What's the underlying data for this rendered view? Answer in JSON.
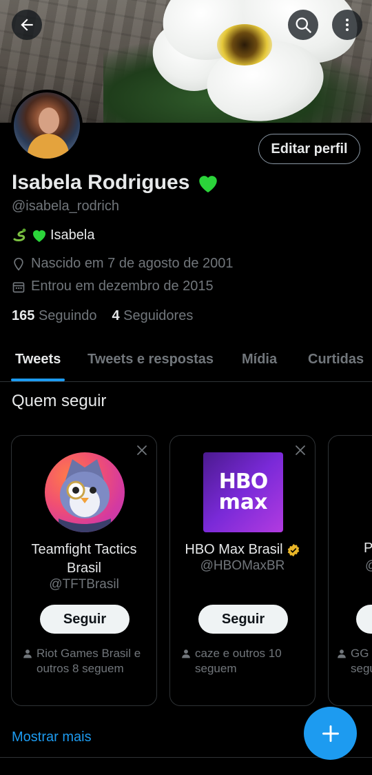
{
  "profile": {
    "name": "Isabela Rodrigues",
    "handle": "@isabela_rodrich",
    "bio": "Isabela",
    "born": "Nascido em 7 de agosto de 2001",
    "joined": "Entrou em dezembro de 2015",
    "following_count": "165",
    "following_label": "Seguindo",
    "followers_count": "4",
    "followers_label": "Seguidores",
    "edit_label": "Editar perfil"
  },
  "tabs": [
    {
      "label": "Tweets",
      "active": true
    },
    {
      "label": "Tweets e respostas",
      "active": false
    },
    {
      "label": "Mídia",
      "active": false
    },
    {
      "label": "Curtidas",
      "active": false
    }
  ],
  "who_to_follow": {
    "title": "Quem seguir",
    "show_more": "Mostrar mais",
    "cards": [
      {
        "name_line1": "Teamfight Tactics",
        "name_line2": "Brasil",
        "handle": "@TFTBrasil",
        "follow_label": "Seguir",
        "social_line1": "Riot Games Brasil e",
        "social_line2": "outros 8 seguem"
      },
      {
        "name": "HBO Max Brasil",
        "verified": true,
        "handle": "@HBOMaxBR",
        "follow_label": "Seguir",
        "social_line1": "caze e outros 10",
        "social_line2": "seguem",
        "logo_line1": "HBO",
        "logo_line2": "max"
      },
      {
        "name_partial": "P",
        "handle_partial": "@",
        "social_line1": "GG (",
        "social_line2": "segu"
      }
    ]
  },
  "colors": {
    "accent": "#1d9bf0",
    "background": "#000000",
    "secondary_text": "#71767b",
    "heart": "#2bd43a"
  },
  "icons": {
    "back": "arrow-left-icon",
    "search": "search-icon",
    "more": "more-vertical-icon",
    "location": "location-icon",
    "calendar": "calendar-icon",
    "close": "close-icon",
    "person": "person-icon",
    "fab": "plus-icon"
  }
}
